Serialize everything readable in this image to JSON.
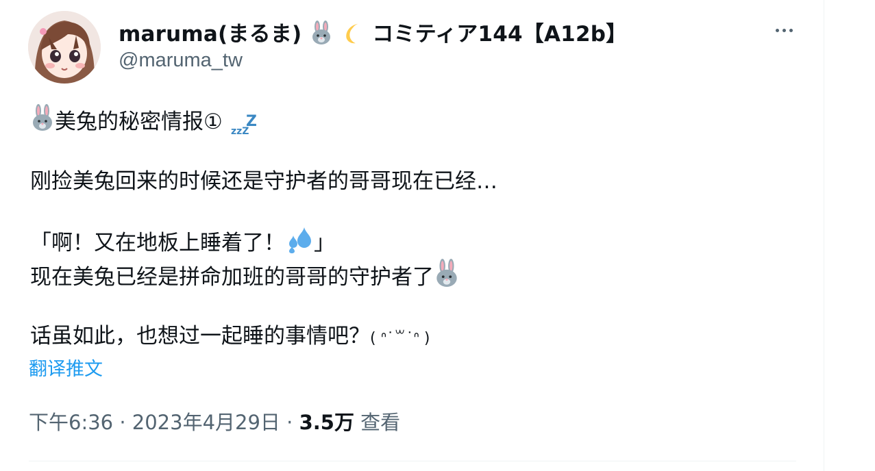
{
  "author": {
    "display_name": "maruma(まるま)",
    "name_suffix": "コミティア144【A12b】",
    "handle": "@maruma_tw",
    "avatar_icon": "anime-girl-avatar"
  },
  "tweet": {
    "line1": "美兔的秘密情报①",
    "line1_zzz": "zzZ",
    "line2": "刚捡美兔回来的时候还是守护者的哥哥现在已经…",
    "line3_start": "「啊！又在地板上睡着了！",
    "line3_end": "」",
    "line4": "现在美兔已经是拼命加班的哥哥的守护者了",
    "line5": "话虽如此，也想过一起睡的事情吧？",
    "line5_face": "( ᐢ˙꒳​˙ᐢ )"
  },
  "translate_link": "翻译推文",
  "meta": {
    "time": "下午6:36",
    "sep1": " · ",
    "date": "2023年4月29日",
    "sep2": " · ",
    "views_count": "3.5万",
    "views_label": " 查看"
  },
  "icons": {
    "rabbit": "rabbit-face-icon",
    "moon": "crescent-moon-icon",
    "sweat": "sweat-droplets-icon",
    "more": "more-dots-icon"
  }
}
